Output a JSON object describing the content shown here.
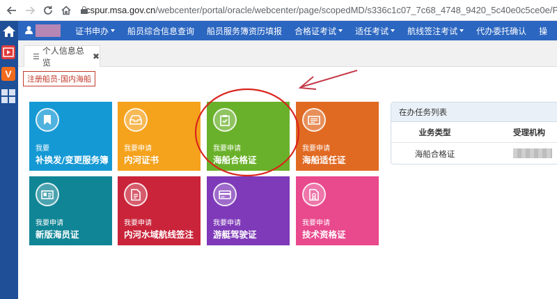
{
  "browser": {
    "url_domain": "cspur.msa.gov.cn",
    "url_path": "/webcenter/portal/oracle/webcenter/page/scopedMD/s336c1c07_7c68_4748_9420_5c40e0c5ce0e/PortalS"
  },
  "topnav": {
    "items": [
      {
        "label": "证书申办",
        "dropdown": true
      },
      {
        "label": "船员综合信息查询",
        "dropdown": false
      },
      {
        "label": "船员服务簿资历填报",
        "dropdown": false
      },
      {
        "label": "合格证考试",
        "dropdown": true
      },
      {
        "label": "适任考试",
        "dropdown": true
      },
      {
        "label": "航线签注考试",
        "dropdown": true
      },
      {
        "label": "代办委托确认",
        "dropdown": false
      },
      {
        "label": "操",
        "dropdown": false
      }
    ]
  },
  "tab": {
    "label": "个人信息总览",
    "close": "✖"
  },
  "role_label": "注册船员-国内海船",
  "tiles": [
    {
      "small": "我要",
      "big": "补换发/变更服务簿",
      "color": "#1599d4",
      "icon": "bookmark-icon"
    },
    {
      "small": "我要申请",
      "big": "内河证书",
      "color": "#f5a21c",
      "icon": "inbox-icon"
    },
    {
      "small": "我要申请",
      "big": "海船合格证",
      "color": "#6ab12b",
      "icon": "clipboard-check-icon"
    },
    {
      "small": "我要申请",
      "big": "海船适任证",
      "color": "#e16a23",
      "icon": "card-icon"
    },
    {
      "small": "我要申请",
      "big": "新版海员证",
      "color": "#108596",
      "icon": "id-card-icon"
    },
    {
      "small": "我要申请",
      "big": "内河水域航线签注",
      "color": "#c9243a",
      "icon": "document-icon"
    },
    {
      "small": "我要申请",
      "big": "游艇驾驶证",
      "color": "#7e3ab8",
      "icon": "credit-card-icon"
    },
    {
      "small": "我要申请",
      "big": "技术资格证",
      "color": "#e9498d",
      "icon": "certificate-icon"
    }
  ],
  "task_panel": {
    "title": "在办任务列表",
    "col_type": "业务类型",
    "col_org": "受理机构",
    "rows": [
      {
        "type": "海船合格证",
        "org": ""
      }
    ]
  }
}
